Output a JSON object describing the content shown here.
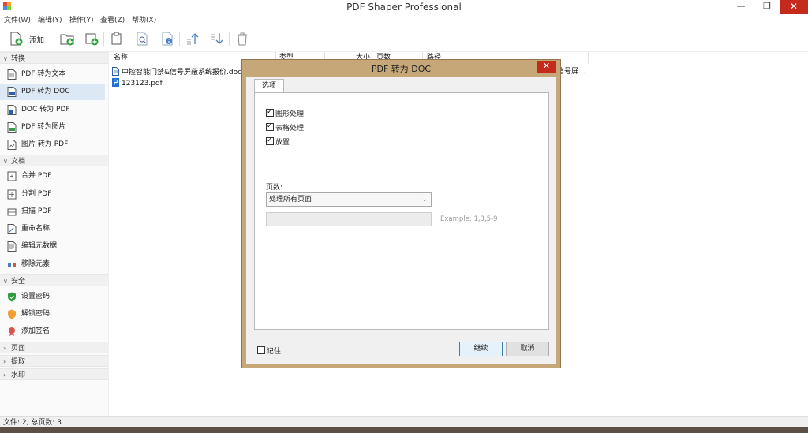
{
  "window": {
    "title": "PDF Shaper Professional",
    "min_glyph": "—",
    "max_glyph": "❐",
    "close_glyph": "✕"
  },
  "menu": [
    "文件(W)",
    "编辑(Y)",
    "操作(Y)",
    "查看(Z)",
    "帮助(X)"
  ],
  "toolbar": {
    "add_label": "添加"
  },
  "sidebar": {
    "sections": [
      {
        "label": "转换",
        "expanded": true,
        "items": [
          "PDF 转为文本",
          "PDF 转为 DOC",
          "DOC 转为 PDF",
          "PDF 转为图片",
          "图片 转为 PDF"
        ]
      },
      {
        "label": "文档",
        "expanded": true,
        "items": [
          "合并 PDF",
          "分割 PDF",
          "扫描 PDF",
          "重命名称",
          "编辑元数据",
          "移除元素"
        ]
      },
      {
        "label": "安全",
        "expanded": true,
        "items": [
          "设置密码",
          "解锁密码",
          "添加签名"
        ]
      },
      {
        "label": "页面",
        "expanded": false
      },
      {
        "label": "提取",
        "expanded": false
      },
      {
        "label": "水印",
        "expanded": false
      }
    ],
    "selected": "PDF 转为 DOC"
  },
  "file_list": {
    "columns": [
      "名称",
      "类型",
      "大小",
      "页数",
      "路径"
    ],
    "rows": [
      {
        "name": "中控智能门禁&信号屏蔽系统报价.doc",
        "path_suffix": "信号屏..."
      },
      {
        "name": "123123.pdf"
      }
    ]
  },
  "status": "文件: 2, 总页数: 3",
  "dialog": {
    "title": "PDF 转为 DOC",
    "close_glyph": "✕",
    "tab": "选项",
    "checkboxes": [
      {
        "label": "图形处理",
        "checked": true
      },
      {
        "label": "表格处理",
        "checked": true
      },
      {
        "label": "放置",
        "checked": true
      }
    ],
    "pages_label": "页数:",
    "pages_select": "处理所有页面",
    "pages_input_value": "",
    "example": "Example: 1,3,5-9",
    "remember_label": "记住",
    "remember_checked": false,
    "continue_label": "继续",
    "cancel_label": "取消"
  },
  "colors": {
    "dialog_frame": "#c6a878",
    "close_red": "#c42b1c",
    "selected_item": "#dde8f5"
  }
}
